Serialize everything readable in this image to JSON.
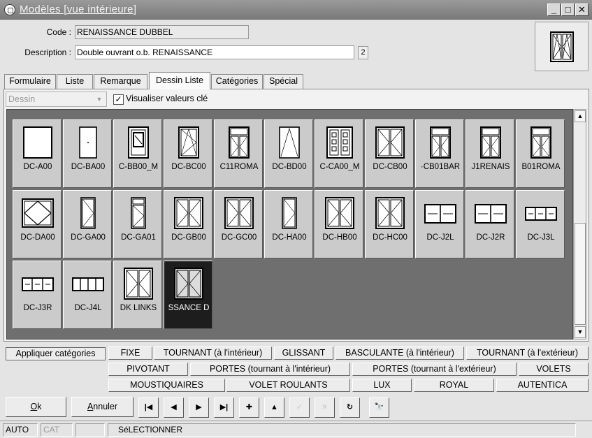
{
  "window": {
    "title": "Modèles [vue intérieure]",
    "minimize": "_",
    "maximize": "□",
    "close": "✕"
  },
  "form": {
    "code_label": "Code :",
    "code_value": "RENAISSANCE DUBBEL",
    "description_label": "Description :",
    "description_value": "Double ouvrant o.b. RENAISSANCE",
    "description_badge": "2"
  },
  "tabs": [
    "Formulaire",
    "Liste",
    "Remarque",
    "Dessin Liste",
    "Catégories",
    "Spécial"
  ],
  "active_tab": "Dessin Liste",
  "toolbar": {
    "combo_value": "Dessin",
    "checkbox_label": "Visualiser valeurs clé",
    "checkbox_checked": true
  },
  "gallery": {
    "items": [
      {
        "label": "DC-A00",
        "icon": "fixed-window-icon"
      },
      {
        "label": "DC-BA00",
        "icon": "door-icon"
      },
      {
        "label": "C-BB00_M",
        "icon": "door-window-icon"
      },
      {
        "label": "DC-BC00",
        "icon": "tilt-turn-window-icon"
      },
      {
        "label": "C11ROMA",
        "icon": "double-transom-window-icon"
      },
      {
        "label": "DC-BD00",
        "icon": "pivot-window-icon"
      },
      {
        "label": "C-CA00_M",
        "icon": "panel-door-icon"
      },
      {
        "label": "DC-CB00",
        "icon": "double-casement-icon"
      },
      {
        "label": "·CB01BAR",
        "icon": "double-transom-window-icon"
      },
      {
        "label": "J1RENAIS",
        "icon": "double-transom-window-icon"
      },
      {
        "label": "B01ROMA",
        "icon": "double-transom-window-icon"
      },
      {
        "label": "DC-DA00",
        "icon": "pivot-square-icon"
      },
      {
        "label": "DC-GA00",
        "icon": "narrow-casement-icon"
      },
      {
        "label": "DC-GA01",
        "icon": "narrow-transom-icon"
      },
      {
        "label": "DC-GB00",
        "icon": "double-casement-icon"
      },
      {
        "label": "DC-GC00",
        "icon": "double-casement-icon"
      },
      {
        "label": "DC-HA00",
        "icon": "narrow-casement-icon"
      },
      {
        "label": "DC-HB00",
        "icon": "double-casement-icon"
      },
      {
        "label": "DC-HC00",
        "icon": "double-casement-icon"
      },
      {
        "label": "DC-J2L",
        "icon": "sliding-2-icon"
      },
      {
        "label": "DC-J2R",
        "icon": "sliding-2-icon"
      },
      {
        "label": "DC-J3L",
        "icon": "sliding-3-icon"
      },
      {
        "label": "DC-J3R",
        "icon": "sliding-3-icon"
      },
      {
        "label": "DC-J4L",
        "icon": "sliding-4-icon"
      },
      {
        "label": "DK LINKS",
        "icon": "double-casement-icon"
      },
      {
        "label": "SSANCE D",
        "icon": "double-casement-icon",
        "selected": true
      }
    ]
  },
  "categories": {
    "apply_label": "Appliquer catégories",
    "row1": [
      "FIXE",
      "TOURNANT (à l'intérieur)",
      "GLISSANT",
      "BASCULANTE (à l'intérieur)",
      "TOURNANT (à l'extérieur)"
    ],
    "row2": [
      "PIVOTANT",
      "PORTES (tournant à l'intérieur)",
      "PORTES (tournant à l'extérieur)",
      "VOLETS"
    ],
    "row3": [
      "MOUSTIQUAIRES",
      "VOLET ROULANTS",
      "LUX",
      "ROYAL",
      "AUTENTICA"
    ]
  },
  "buttons": {
    "ok_hotkey": "O",
    "ok_rest": "k",
    "cancel_hotkey": "A",
    "cancel_rest": "nnuler",
    "nav": [
      {
        "name": "first-record-icon",
        "glyph": "|◀"
      },
      {
        "name": "previous-record-icon",
        "glyph": "◀"
      },
      {
        "name": "next-record-icon",
        "glyph": "▶"
      },
      {
        "name": "last-record-icon",
        "glyph": "▶|"
      },
      {
        "name": "add-record-icon",
        "glyph": "✚"
      },
      {
        "name": "move-up-icon",
        "glyph": "▲"
      },
      {
        "name": "confirm-icon",
        "glyph": "✓",
        "disabled": true
      },
      {
        "name": "delete-icon",
        "glyph": "✕",
        "disabled": true
      },
      {
        "name": "refresh-icon",
        "glyph": "↻"
      },
      {
        "name": "search-binoculars-icon",
        "glyph": "🔭"
      }
    ]
  },
  "status": {
    "mode": "AUTO",
    "cat": "CAT",
    "action": "SéLECTIONNER"
  },
  "colors": {
    "gallery_bg": "#6f6f6f",
    "tile_bg": "#cbcbcb",
    "selected_tile": "#1d1d1d"
  }
}
